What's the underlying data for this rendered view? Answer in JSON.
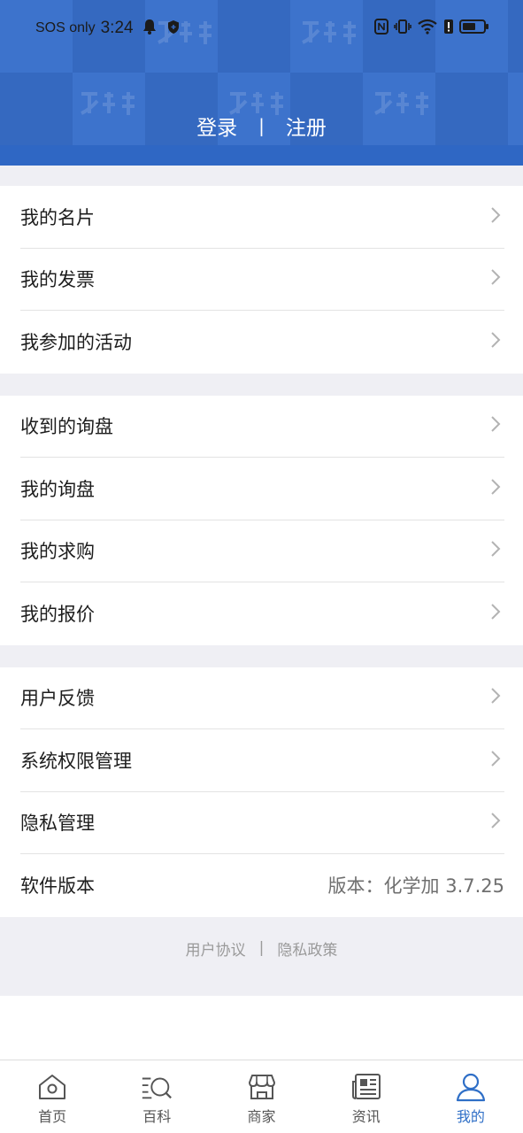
{
  "status_bar": {
    "carrier": "SOS only",
    "time": "3:24"
  },
  "header": {
    "login": "登录",
    "separator": "|",
    "register": "注册"
  },
  "groups": [
    {
      "items": [
        {
          "label": "我的名片"
        },
        {
          "label": "我的发票"
        },
        {
          "label": "我参加的活动"
        }
      ]
    },
    {
      "items": [
        {
          "label": "收到的询盘"
        },
        {
          "label": "我的询盘"
        },
        {
          "label": "我的求购"
        },
        {
          "label": "我的报价"
        }
      ]
    },
    {
      "items": [
        {
          "label": "用户反馈"
        },
        {
          "label": "系统权限管理"
        },
        {
          "label": "隐私管理"
        },
        {
          "label": "软件版本",
          "value": "版本：化学加 3.7.25"
        }
      ]
    }
  ],
  "footer": {
    "user_agreement": "用户协议",
    "separator": "|",
    "privacy_policy": "隐私政策"
  },
  "tabbar": {
    "active_color": "#2f6fc7",
    "items": [
      {
        "label": "首页",
        "icon": "home-icon"
      },
      {
        "label": "百科",
        "icon": "encyclopedia-icon"
      },
      {
        "label": "商家",
        "icon": "store-icon"
      },
      {
        "label": "资讯",
        "icon": "news-icon"
      },
      {
        "label": "我的",
        "icon": "profile-icon",
        "active": true
      }
    ]
  }
}
